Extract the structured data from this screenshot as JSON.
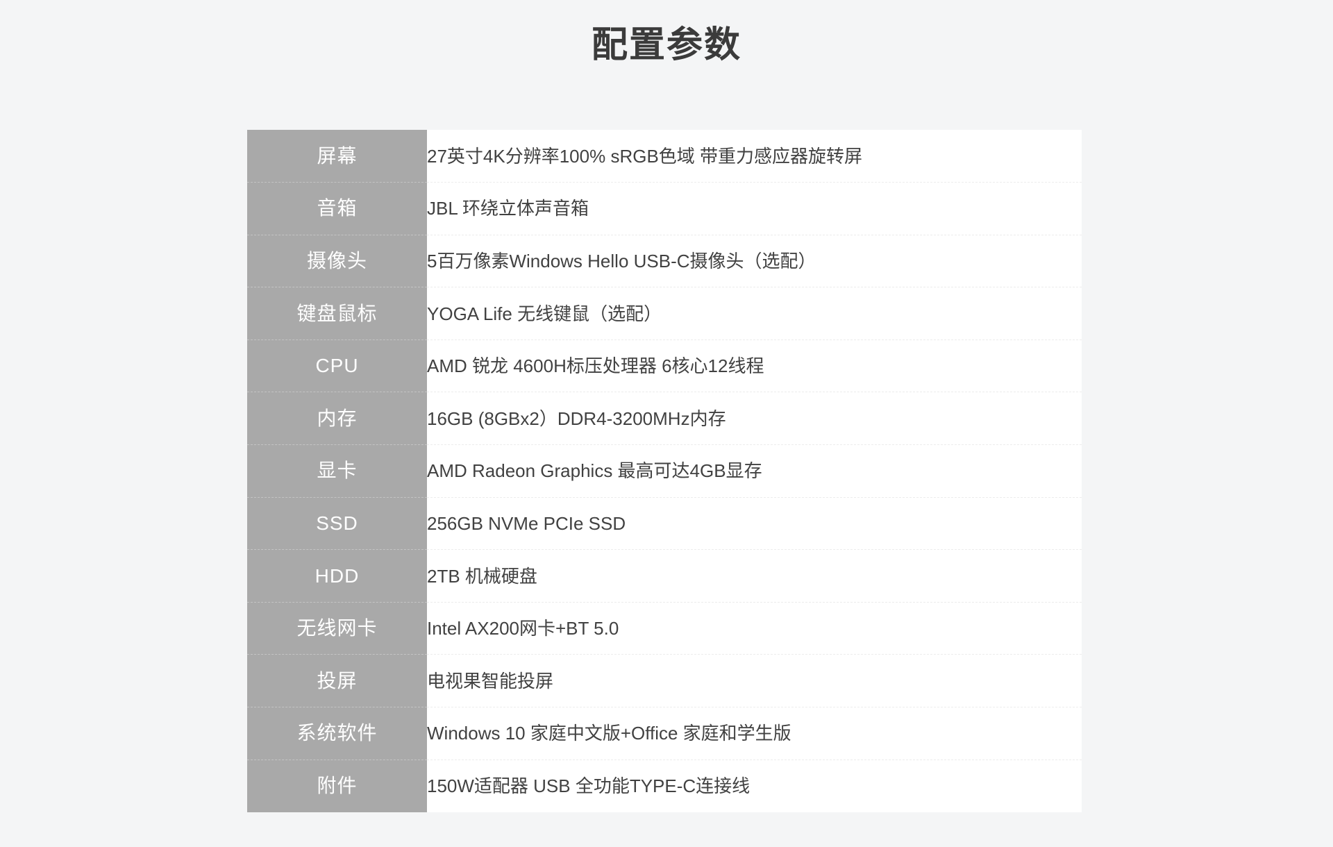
{
  "header": {
    "title": "配置参数"
  },
  "colors": {
    "page_background": "#f4f5f6",
    "label_column_background": "#a9a9a9",
    "value_column_background": "#ffffff",
    "title_text": "#3b3b3b",
    "label_text": "#ffffff",
    "value_text": "#414141",
    "label_divider": "#c4c4c4",
    "value_divider": "#ececec"
  },
  "spec_table": {
    "rows": [
      {
        "label": "屏幕",
        "value": "27英寸4K分辨率100% sRGB色域 带重力感应器旋转屏"
      },
      {
        "label": "音箱",
        "value": "JBL 环绕立体声音箱"
      },
      {
        "label": "摄像头",
        "value": "5百万像素Windows Hello USB-C摄像头（选配）"
      },
      {
        "label": "键盘鼠标",
        "value": "YOGA Life 无线键鼠（选配）"
      },
      {
        "label": "CPU",
        "value": "AMD 锐龙 4600H标压处理器 6核心12线程"
      },
      {
        "label": "内存",
        "value": "16GB (8GBx2）DDR4-3200MHz内存"
      },
      {
        "label": "显卡",
        "value": "AMD Radeon Graphics 最高可达4GB显存"
      },
      {
        "label": "SSD",
        "value": "256GB NVMe PCIe SSD"
      },
      {
        "label": "HDD",
        "value": "2TB 机械硬盘"
      },
      {
        "label": "无线网卡",
        "value": "Intel AX200网卡+BT 5.0"
      },
      {
        "label": "投屏",
        "value": "电视果智能投屏"
      },
      {
        "label": "系统软件",
        "value": "Windows 10 家庭中文版+Office 家庭和学生版"
      },
      {
        "label": "附件",
        "value": "150W适配器 USB 全功能TYPE-C连接线"
      }
    ]
  }
}
